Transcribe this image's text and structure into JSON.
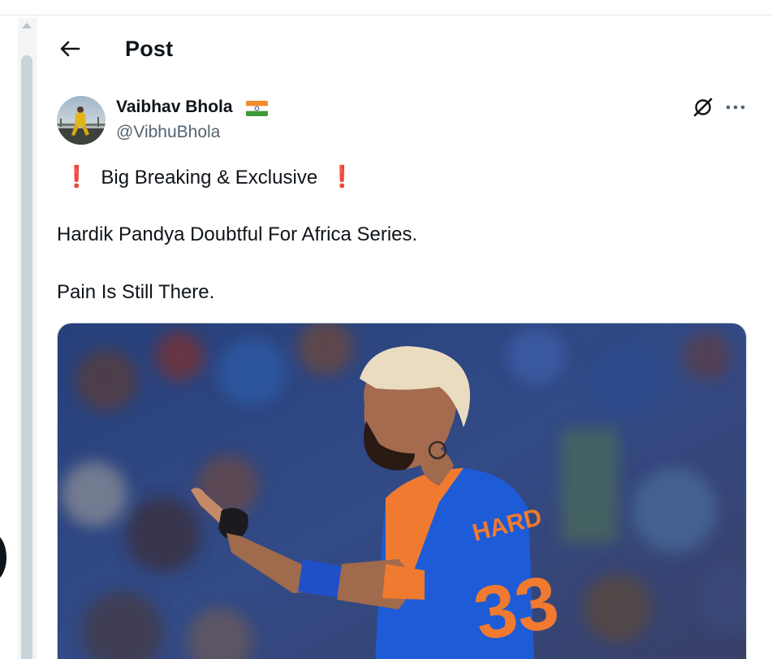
{
  "header": {
    "title": "Post"
  },
  "post": {
    "author": {
      "display_name": "Vaibhav Bhola",
      "handle": "@VibhuBhola",
      "flag": "india-flag-emoji"
    },
    "text": {
      "line1": "Big Breaking & Exclusive",
      "line1_marker": "❗",
      "line2": "Hardik Pandya Doubtful For Africa Series.",
      "line3": "Pain Is Still There."
    },
    "media": {
      "jersey_name": "HARD",
      "jersey_number": "33"
    }
  },
  "icons": {
    "back": "arrow-left-icon",
    "grok": "grok-icon",
    "more": "more-horizontal-icon"
  },
  "colors": {
    "text_primary": "#0f1419",
    "text_secondary": "#536471",
    "exclamation": "#d0142c",
    "jersey_blue": "#1e5bd7",
    "jersey_orange": "#f07a2f"
  }
}
